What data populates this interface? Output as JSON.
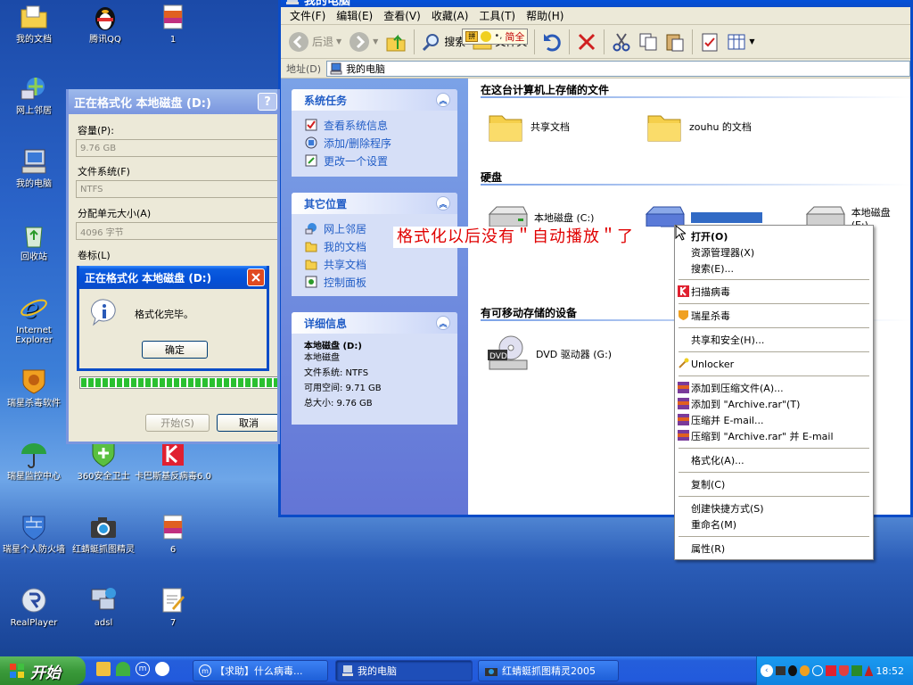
{
  "desktop_icons": [
    {
      "label": "我的文档",
      "icon": "folder-documents-icon"
    },
    {
      "label": "腾讯QQ",
      "icon": "qq-penguin-icon"
    },
    {
      "label": "1",
      "icon": "rar-archive-icon"
    },
    {
      "label": "网上邻居",
      "icon": "network-places-icon"
    },
    {
      "label": "我的电脑",
      "icon": "my-computer-icon"
    },
    {
      "label": "回收站",
      "icon": "recycle-bin-icon"
    },
    {
      "label": "Internet Explorer",
      "icon": "ie-icon"
    },
    {
      "label": "瑞星杀毒软件",
      "icon": "rising-lion-icon"
    },
    {
      "label": "瑞星监控中心",
      "icon": "umbrella-icon"
    },
    {
      "label": "360安全卫士",
      "icon": "shield-360-icon"
    },
    {
      "label": "卡巴斯基反病毒6.0",
      "icon": "kaspersky-icon"
    },
    {
      "label": "瑞星个人防火墙",
      "icon": "firewall-icon"
    },
    {
      "label": "红蜻蜓抓图精灵",
      "icon": "camera-icon"
    },
    {
      "label": "6",
      "icon": "rar-archive-icon"
    },
    {
      "label": "RealPlayer",
      "icon": "realplayer-icon"
    },
    {
      "label": "adsl",
      "icon": "network-connection-icon"
    },
    {
      "label": "7",
      "icon": "text-file-icon"
    }
  ],
  "explorer": {
    "title": "我的电脑",
    "menus": [
      "文件(F)",
      "编辑(E)",
      "查看(V)",
      "收藏(A)",
      "工具(T)",
      "帮助(H)"
    ],
    "toolbar": {
      "back": "后退",
      "search": "搜索",
      "folders": "文件夹",
      "ime": "简全"
    },
    "address_label": "地址(D)",
    "address_value": "我的电脑",
    "tasks_panel": {
      "title": "系统任务",
      "items": [
        "查看系统信息",
        "添加/删除程序",
        "更改一个设置"
      ]
    },
    "places_panel": {
      "title": "其它位置",
      "items": [
        "网上邻居",
        "我的文档",
        "共享文档",
        "控制面板"
      ]
    },
    "details_panel": {
      "title": "详细信息",
      "name": "本地磁盘 (D:)",
      "type": "本地磁盘",
      "fs": "文件系统: NTFS",
      "free": "可用空间: 9.71 GB",
      "total": "总大小: 9.76 GB"
    },
    "section_files": "在这台计算机上存储的文件",
    "shared_docs": "共享文档",
    "user_docs": "zouhu 的文档",
    "section_disks": "硬盘",
    "disk_c": "本地磁盘 (C:)",
    "disk_e": "本地磁盘 (E:)",
    "section_removable": "有可移动存储的设备",
    "dvd": "DVD 驱动器 (G:)",
    "annotation": "格式化以后没有＂自动播放＂了"
  },
  "context_menu": [
    "打开(O)",
    "资源管理器(X)",
    "搜索(E)...",
    "扫描病毒",
    "瑞星杀毒",
    "共享和安全(H)...",
    "Unlocker",
    "添加到压缩文件(A)...",
    "添加到 \"Archive.rar\"(T)",
    "压缩并 E-mail...",
    "压缩到 \"Archive.rar\" 并 E-mail",
    "格式化(A)...",
    "复制(C)",
    "创建快捷方式(S)",
    "重命名(M)",
    "属性(R)"
  ],
  "format_dialog": {
    "title": "正在格式化 本地磁盘 (D:)",
    "capacity_label": "容量(P):",
    "capacity_value": "9.76 GB",
    "fs_label": "文件系统(F)",
    "fs_value": "NTFS",
    "alloc_label": "分配单元大小(A)",
    "alloc_value": "4096 字节",
    "volume_label": "卷标(L)",
    "start": "开始(S)",
    "cancel": "取消",
    "progress": 1.0
  },
  "complete_dialog": {
    "title": "正在格式化 本地磁盘 (D:)",
    "message": "格式化完毕。",
    "ok": "确定"
  },
  "taskbar": {
    "start": "开始",
    "tasks": [
      "【求助】什么病毒...",
      "我的电脑",
      "红蜻蜓抓图精灵2005"
    ],
    "clock": "18:52"
  },
  "colors": {
    "accent": "#0a5ce0",
    "link": "#215dc6",
    "annotation": "#e00000"
  }
}
